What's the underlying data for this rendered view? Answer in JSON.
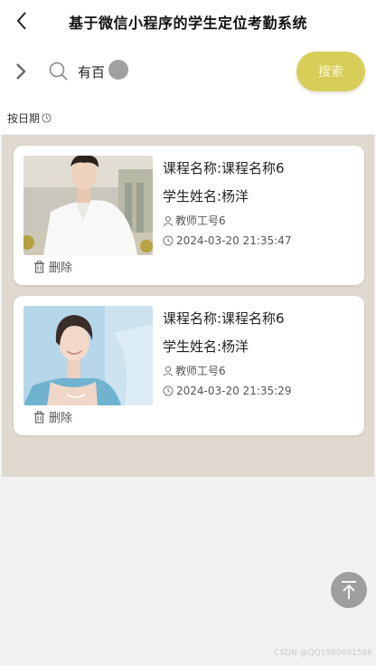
{
  "header": {
    "title": "基于微信小程序的学生定位考勤系统",
    "back_icon": "chevron-left-icon"
  },
  "search": {
    "expand_icon": "chevron-right-icon",
    "search_icon": "search-icon",
    "value": "有百",
    "button_label": "搜索",
    "button_color": "#d7ce58"
  },
  "sort": {
    "label": "按日期",
    "icon": "clock-icon"
  },
  "colors": {
    "list_background": "#e0d9cf",
    "page_background": "#f2f2f2"
  },
  "records": [
    {
      "course": "课程名称:课程名称6",
      "student": "学生姓名:杨洋",
      "teacher": "教师工号6",
      "time": "2024-03-20 21:35:47",
      "delete_label": "删除"
    },
    {
      "course": "课程名称:课程名称6",
      "student": "学生姓名:杨洋",
      "teacher": "教师工号6",
      "time": "2024-03-20 21:35:29",
      "delete_label": "删除"
    }
  ],
  "back_to_top_icon": "arrow-up-to-top-icon",
  "watermark": "CSDN @QQ1980691586"
}
